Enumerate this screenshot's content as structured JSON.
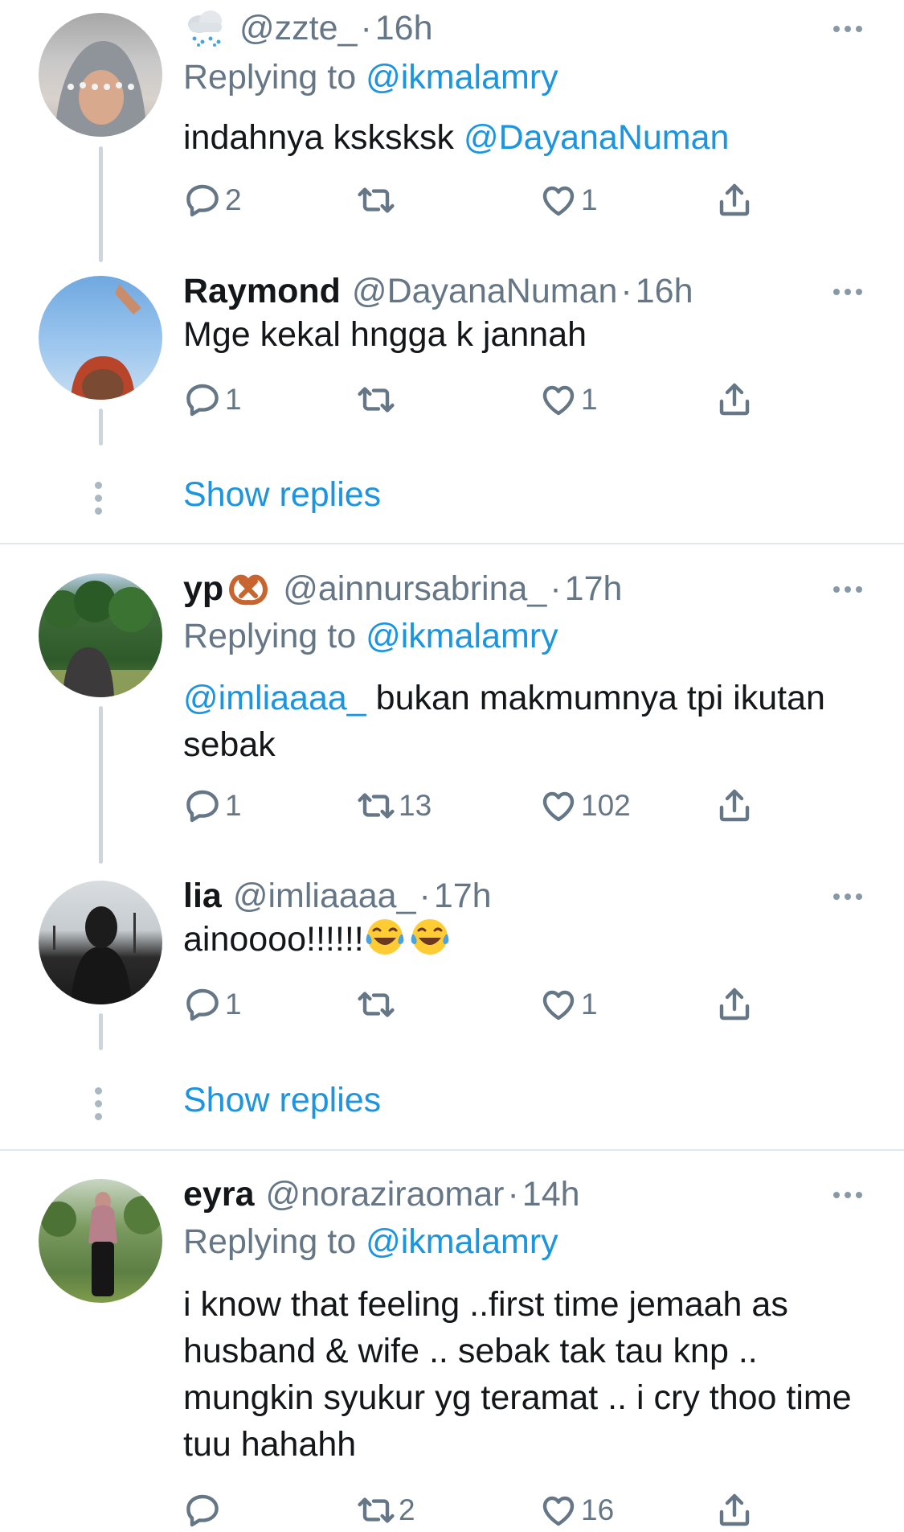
{
  "threads": [
    {
      "tweets": [
        {
          "name": "",
          "name_icon": "cloud-rain-emoji",
          "handle": "@zzte_",
          "time": "16h",
          "replying_label": "Replying to",
          "replying_to": "@ikmalamry",
          "text": "indahnya ksksksk",
          "mention_after": "@DayanaNuman",
          "replies": "2",
          "retweets": "",
          "likes": "1"
        },
        {
          "name": "Raymond",
          "handle": "@DayanaNuman",
          "time": "16h",
          "text": "Mge kekal hngga k jannah",
          "replies": "1",
          "retweets": "",
          "likes": "1"
        }
      ],
      "show_replies": "Show replies"
    },
    {
      "tweets": [
        {
          "name": "yp",
          "name_icon": "pretzel-emoji",
          "handle": "@ainnursabrina_",
          "time": "17h",
          "replying_label": "Replying to",
          "replying_to": "@ikmalamry",
          "mention_before": "@imliaaaa_",
          "text": " bukan makmumnya tpi ikutan sebak",
          "replies": "1",
          "retweets": "13",
          "likes": "102"
        },
        {
          "name": "lia",
          "handle": "@imliaaaa_",
          "time": "17h",
          "text": "ainoooo!!!!!!",
          "text_icons": [
            "face-with-tears-of-joy-emoji",
            "face-with-tears-of-joy-emoji"
          ],
          "replies": "1",
          "retweets": "",
          "likes": "1"
        }
      ],
      "show_replies": "Show replies"
    },
    {
      "tweets": [
        {
          "name": "eyra",
          "handle": "@noraziraomar",
          "time": "14h",
          "replying_label": "Replying to",
          "replying_to": "@ikmalamry",
          "text": "i know that feeling ..first time jemaah as husband & wife .. sebak tak tau knp .. mungkin syukur yg teramat .. i cry thoo time tuu hahahh",
          "replies": "",
          "retweets": "2",
          "likes": "16"
        }
      ]
    }
  ],
  "dot": "·",
  "colors": {
    "link": "#1b95e0",
    "secondary": "#657786",
    "line": "#ccd6dd"
  }
}
